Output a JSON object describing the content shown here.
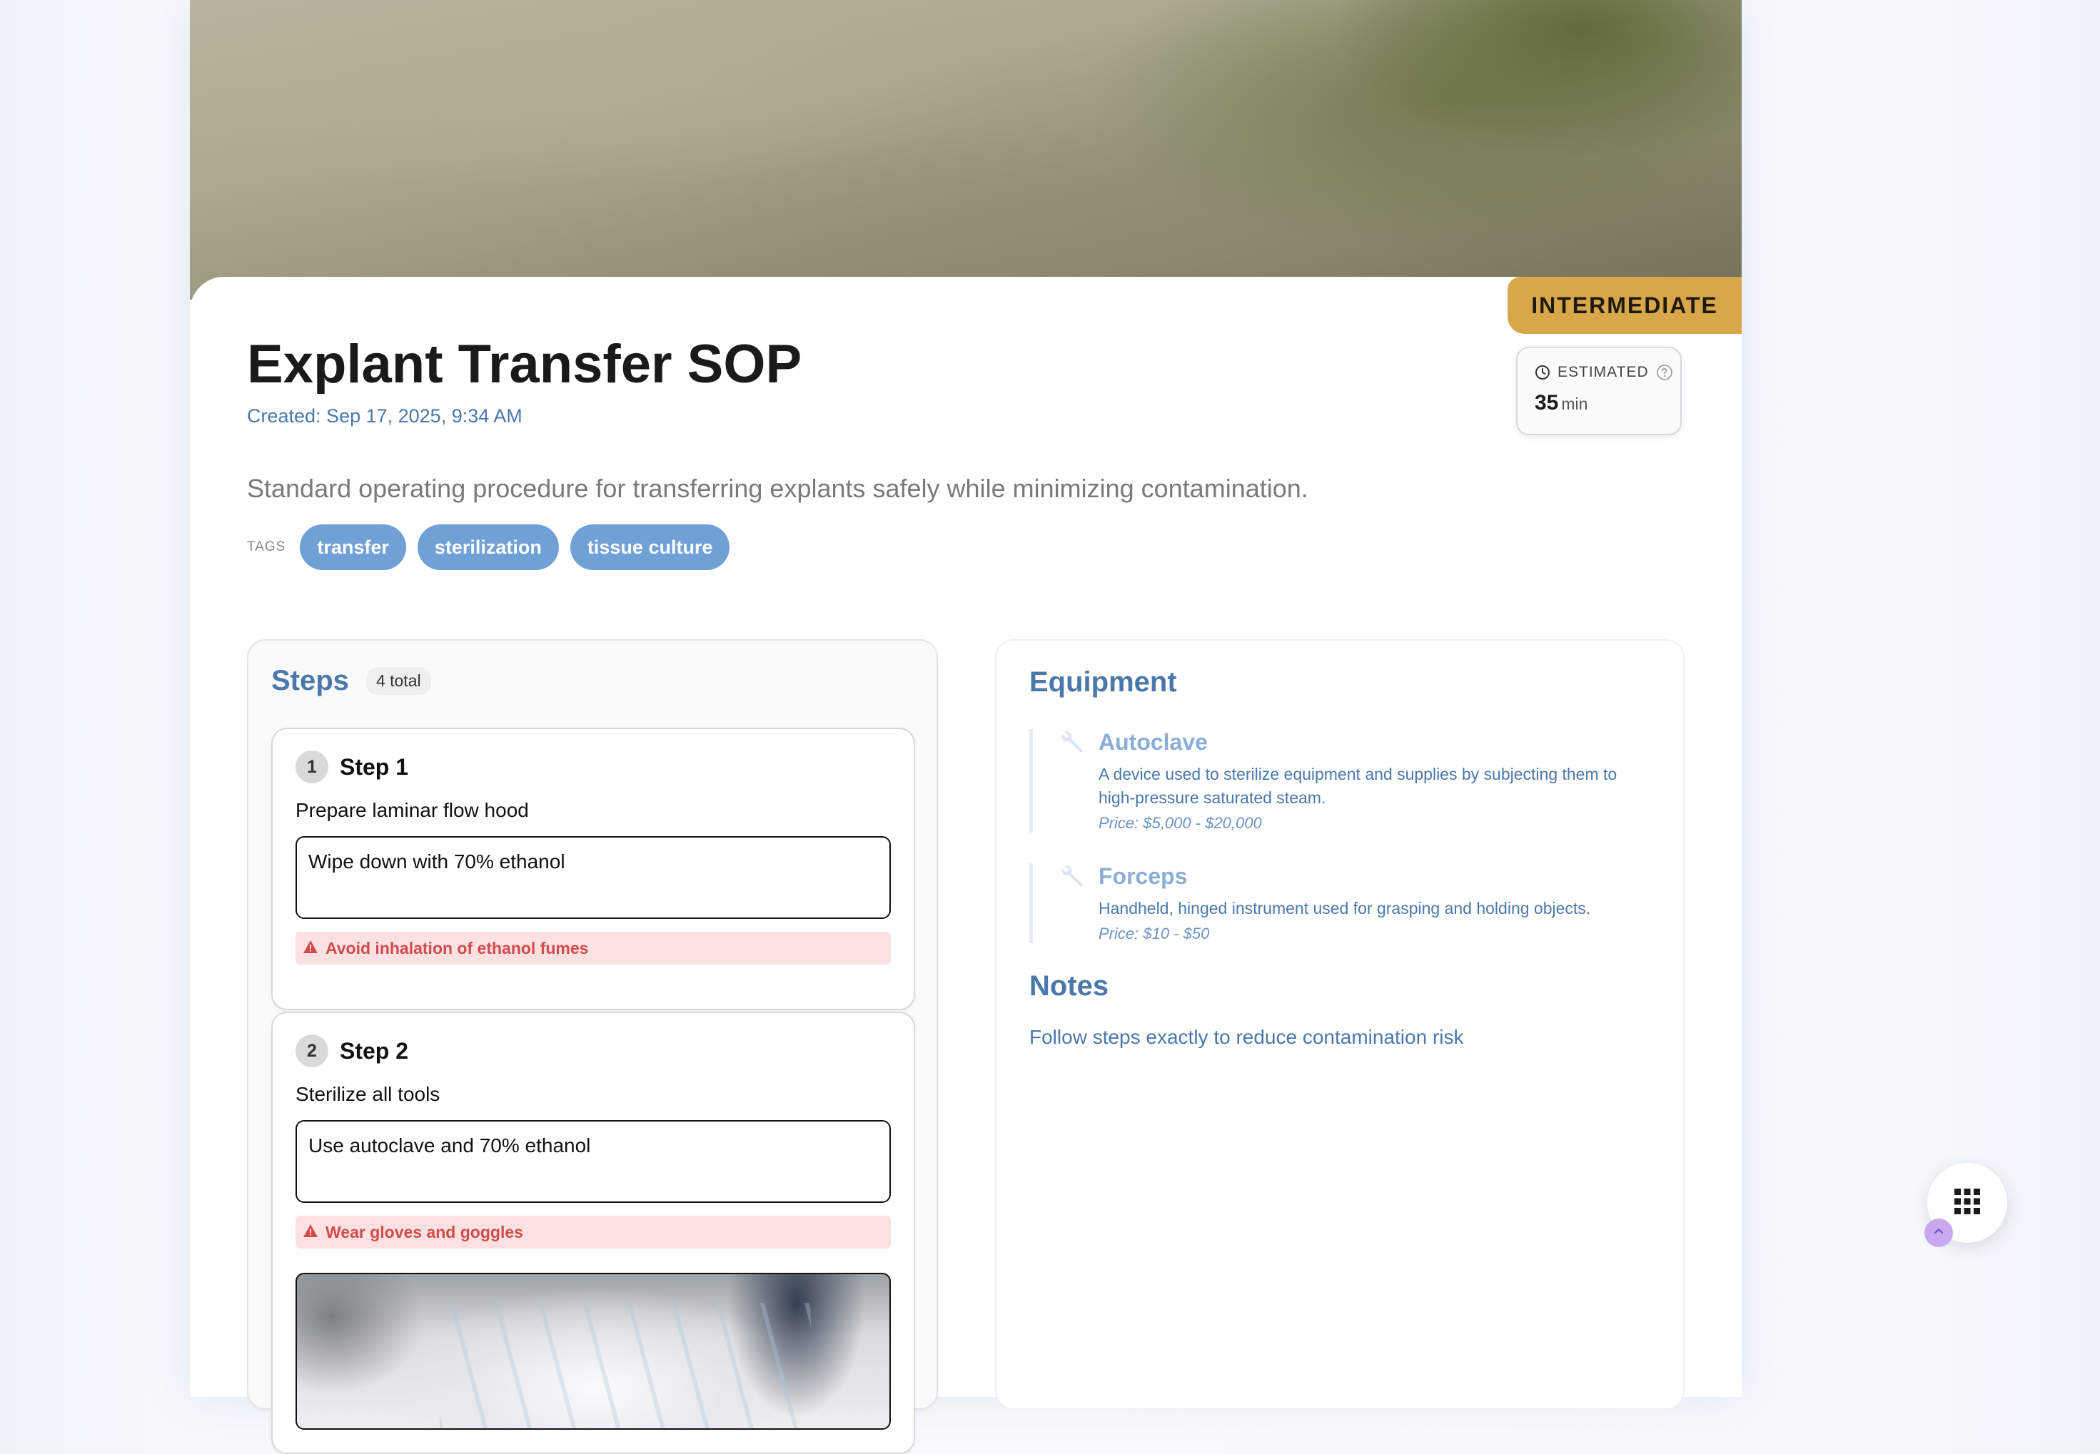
{
  "sop": {
    "title": "Explant Transfer SOP",
    "created": "Created: Sep 17, 2025, 9:34 AM",
    "description": "Standard operating procedure for transferring explants safely while minimizing contamination.",
    "level": "INTERMEDIATE",
    "estimated": {
      "label": "ESTIMATED",
      "value": "35",
      "unit": "min"
    },
    "tags_label": "TAGS",
    "tags": [
      "transfer",
      "sterilization",
      "tissue culture"
    ]
  },
  "steps": {
    "title": "Steps",
    "count": "4 total",
    "items": [
      {
        "number": "1",
        "title": "Step 1",
        "description": "Prepare laminar flow hood",
        "detail": "Wipe down with 70% ethanol",
        "warning": "Avoid inhalation of ethanol fumes"
      },
      {
        "number": "2",
        "title": "Step 2",
        "description": "Sterilize all tools",
        "detail": "Use autoclave and 70% ethanol",
        "warning": "Wear gloves and goggles"
      }
    ]
  },
  "equipment": {
    "title": "Equipment",
    "items": [
      {
        "name": "Autoclave",
        "description": "A device used to sterilize equipment and supplies by subjecting them to high-pressure saturated steam.",
        "price": "Price: $5,000 - $20,000"
      },
      {
        "name": "Forceps",
        "description": "Handheld, hinged instrument used for grasping and holding objects.",
        "price": "Price: $10 - $50"
      }
    ]
  },
  "notes": {
    "title": "Notes",
    "text": "Follow steps exactly to reduce contamination risk"
  },
  "icons": {
    "clock": "clock-icon",
    "help": "help-circle-icon",
    "warning": "warning-triangle-icon",
    "wrench": "wrench-icon",
    "apps": "apps-grid-icon",
    "chevron": "chevron-up-icon"
  },
  "colors": {
    "accent_blue": "#4a78ab",
    "tag_blue": "#6fa0d6",
    "level_gold": "#d8a74a",
    "warning_red": "#d24b4b",
    "warning_bg": "#fbe1e1"
  }
}
